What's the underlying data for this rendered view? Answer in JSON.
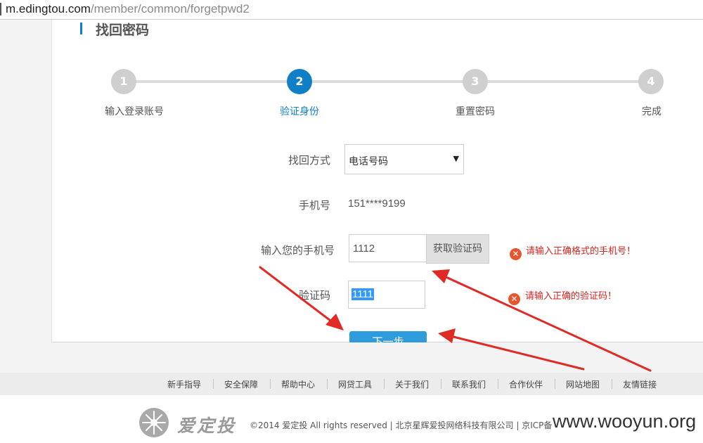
{
  "browser": {
    "url_domain": "m.edingtou.com",
    "url_path": "/member/common/forgetpwd2"
  },
  "page": {
    "title": "找回密码"
  },
  "steps": [
    {
      "number": "1",
      "label": "输入登录账号",
      "active": false
    },
    {
      "number": "2",
      "label": "验证身份",
      "active": true
    },
    {
      "number": "3",
      "label": "重置密码",
      "active": false
    },
    {
      "number": "4",
      "label": "完成",
      "active": false
    }
  ],
  "form": {
    "method_label": "找回方式",
    "method_selected": "电话号码",
    "phone_label": "手机号",
    "phone_masked": "151****9199",
    "enter_phone_label": "输入您的手机号",
    "enter_phone_value": "1112",
    "get_code_label": "获取验证码",
    "phone_error": "请输入正确格式的手机号！",
    "code_label": "验证码",
    "code_value": "1111",
    "code_error": "请输入正确的验证码！",
    "error_icon_glyph": "✕"
  },
  "footer": {
    "nav": [
      "新手指导",
      "安全保障",
      "帮助中心",
      "网贷工具",
      "关于我们",
      "联系我们",
      "合作伙伴",
      "网站地图",
      "友情链接"
    ],
    "logo_text": "爱定投",
    "copyright": "©2014 爱定投 All rights reserved  |  北京星辉爱投网络科技有限公司  |  京ICP备",
    "watermark": "www.wooyun.org"
  },
  "colors": {
    "accent": "#0f7fc8",
    "error": "#d2231e",
    "annotation_arrow": "#e02a26"
  },
  "icons": {
    "select": "chevron-down-icon",
    "error": "error-circle-icon",
    "logo": "logo-icon"
  }
}
